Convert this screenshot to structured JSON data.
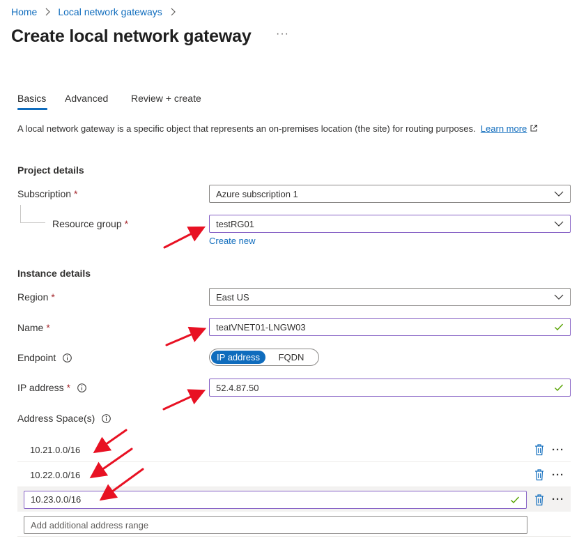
{
  "breadcrumb": {
    "items": [
      "Home",
      "Local network gateways"
    ]
  },
  "page": {
    "title": "Create local network gateway",
    "more": "···"
  },
  "tabs": [
    {
      "label": "Basics",
      "active": true
    },
    {
      "label": "Advanced",
      "active": false
    },
    {
      "label": "Review + create",
      "active": false
    }
  ],
  "description": {
    "text": "A local network gateway is a specific object that represents an on-premises location (the site) for routing purposes.",
    "link_part1": "Learn",
    "link_part2": "more"
  },
  "project_details": {
    "heading": "Project details",
    "subscription_label": "Subscription",
    "subscription_value": "Azure subscription 1",
    "resource_group_label": "Resource group",
    "resource_group_value": "testRG01",
    "create_new": "Create new"
  },
  "instance_details": {
    "heading": "Instance details",
    "region_label": "Region",
    "region_value": "East US",
    "name_label": "Name",
    "name_value": "teatVNET01-LNGW03",
    "endpoint_label": "Endpoint",
    "endpoint_options": [
      "IP address",
      "FQDN"
    ],
    "endpoint_selected": "IP address",
    "ip_label": "IP address",
    "ip_value": "52.4.87.50",
    "address_space_label": "Address Space(s)"
  },
  "address_spaces": [
    "10.21.0.0/16",
    "10.22.0.0/16",
    "10.23.0.0/16"
  ],
  "add_address_placeholder": "Add additional address range",
  "required_mark": "*",
  "colors": {
    "link": "#0f6cbd",
    "focus_border": "#8661c5",
    "required": "#a4262c",
    "valid_check": "#57a300",
    "annotation_arrow": "#e81123"
  }
}
